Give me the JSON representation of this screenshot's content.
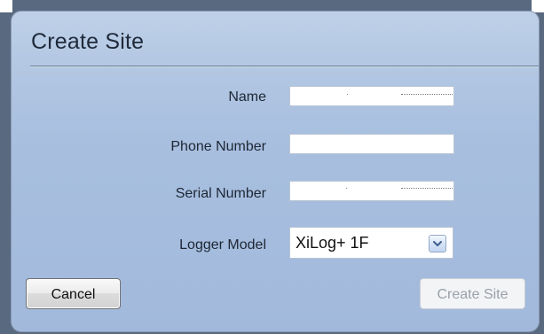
{
  "dialog": {
    "title": "Create Site",
    "labels": {
      "name": "Name",
      "phone_number": "Phone Number",
      "serial_number": "Serial Number",
      "logger_model": "Logger Model"
    },
    "fields": {
      "name": {
        "value": ""
      },
      "phone_number": {
        "value": ""
      },
      "serial_number": {
        "value": ""
      },
      "logger_model": {
        "selected": "XiLog+ 1F"
      }
    },
    "buttons": {
      "cancel": "Cancel",
      "create_site": "Create Site"
    }
  },
  "icons": {
    "dropdown": "chevron-down-icon"
  },
  "colors": {
    "background": "#59697f",
    "dialog_top": "#bfd1e8",
    "dialog_bottom": "#a2b9dc",
    "disabled_text": "#9aa1aa"
  }
}
